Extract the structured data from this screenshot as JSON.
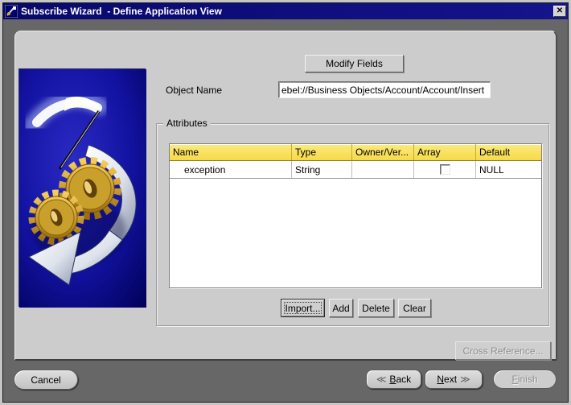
{
  "window": {
    "title": "Subscribe Wizard  - Define Application View",
    "close_glyph": "✕"
  },
  "toolbar": {
    "modify_fields_label": "Modify Fields",
    "object_name_label": "Object Name",
    "object_name_value": "ebel://Business Objects/Account/Account/Insert"
  },
  "attributes": {
    "legend": "Attributes",
    "table": {
      "columns": [
        "Name",
        "Type",
        "Owner/Ver...",
        "Array",
        "Default"
      ],
      "rows": [
        {
          "name": "exception",
          "type": "String",
          "owner_ver": "",
          "array_checked": false,
          "default": "NULL"
        }
      ]
    },
    "buttons": {
      "import_label": "Import...",
      "add_label": "Add",
      "delete_label": "Delete",
      "clear_label": "Clear"
    }
  },
  "cross_reference": {
    "label": "Cross Reference...",
    "enabled": false
  },
  "footer": {
    "cancel_label": "Cancel",
    "back": {
      "glyph": "≪",
      "key": "B",
      "rest": "ack"
    },
    "next": {
      "glyph": "≫",
      "key": "N",
      "rest": "ext"
    },
    "finish": {
      "key": "F",
      "rest": "inish",
      "enabled": false
    }
  },
  "colors": {
    "titlebar": "#0d0d7e",
    "table_header": "#f6da48",
    "panel": "#cccccc",
    "window_bg": "#676767",
    "image_blue": "#1212a0",
    "gear_gold": "#d8a427"
  }
}
